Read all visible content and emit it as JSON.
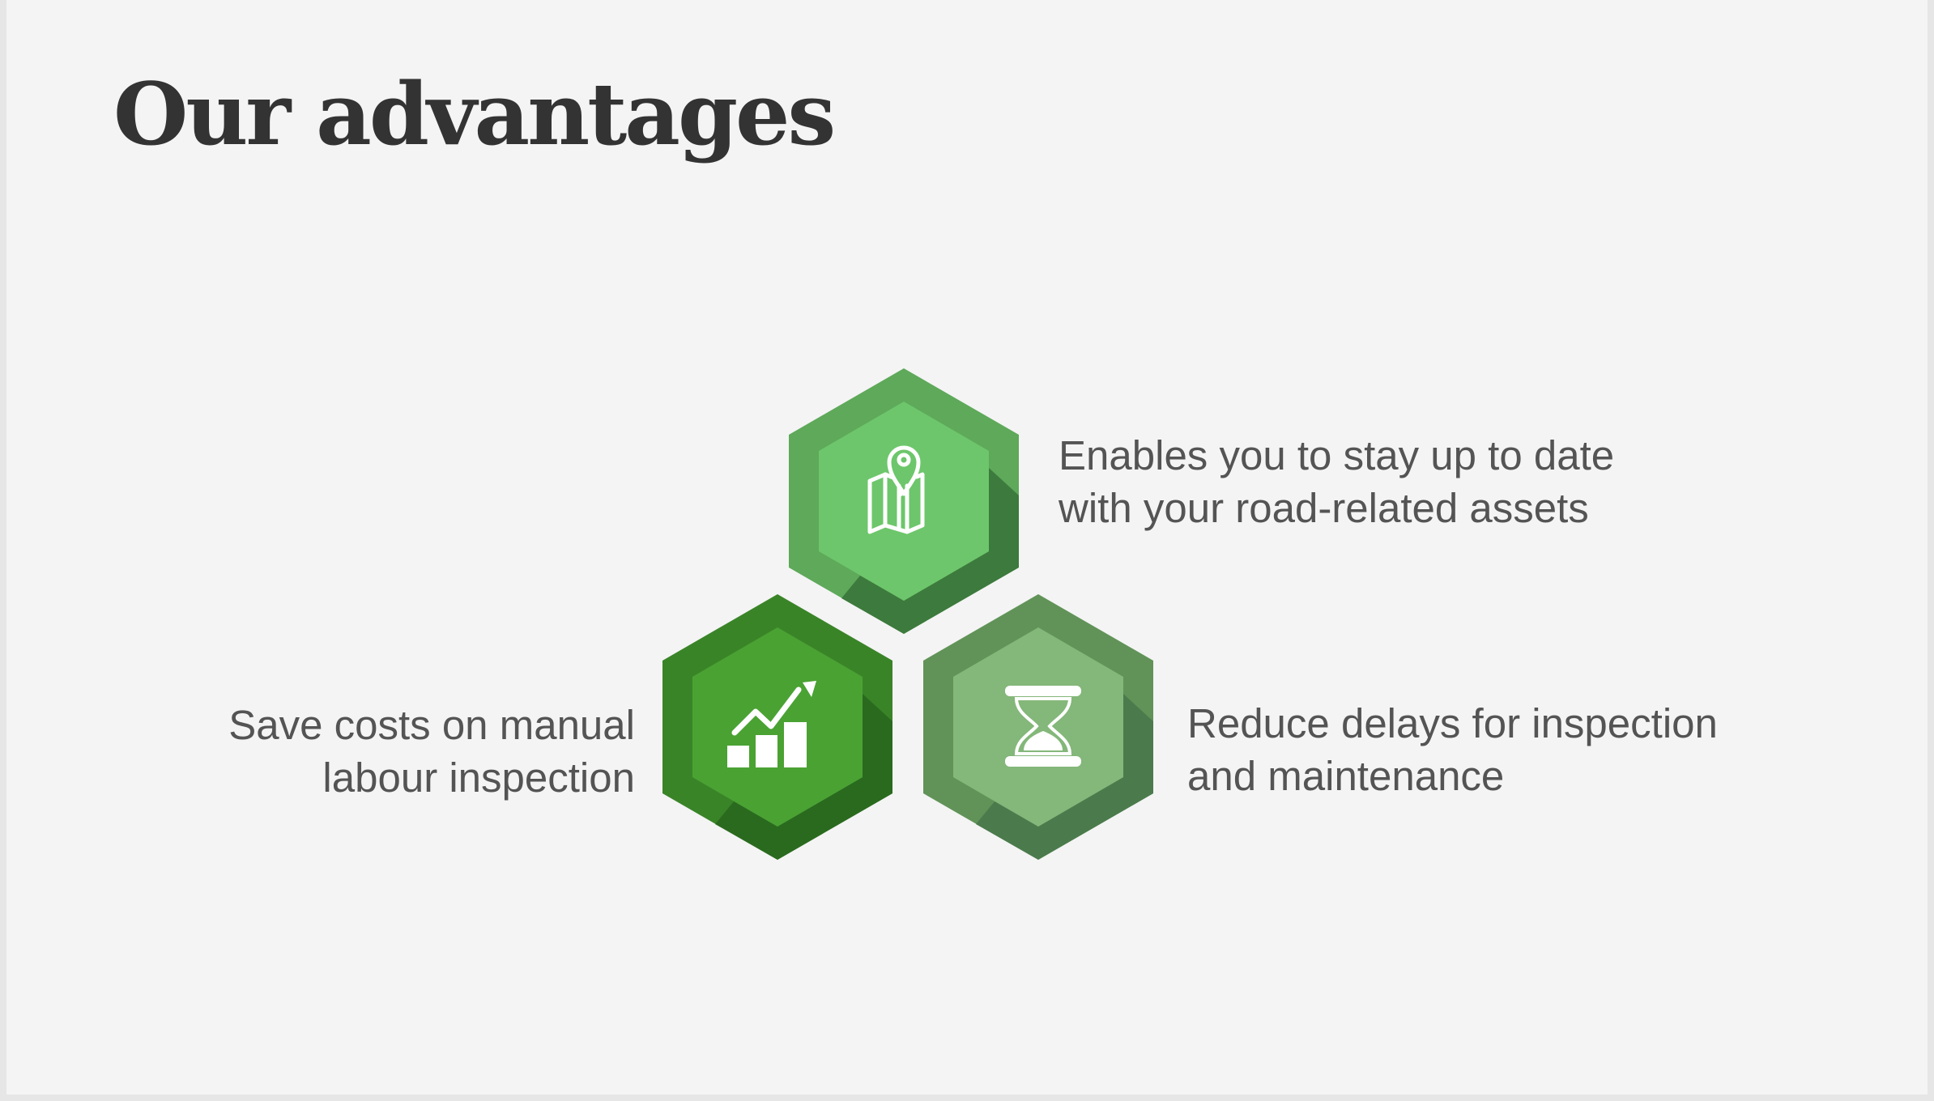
{
  "slide": {
    "title": "Our advantages"
  },
  "advantages": [
    {
      "icon": "map-pin-icon",
      "line1": "Enables you to stay up to date",
      "line2": "with your road-related assets",
      "colors": {
        "outer": "#5ea95a",
        "inner": "#6dc66b",
        "shadow": "#3d7a3d"
      }
    },
    {
      "icon": "growth-chart-icon",
      "line1": "Save costs on manual",
      "line2": "labour inspection",
      "colors": {
        "outer": "#3a8428",
        "inner": "#4aa233",
        "shadow": "#2a6a1f"
      }
    },
    {
      "icon": "hourglass-icon",
      "line1": "Reduce delays for inspection",
      "line2": "and maintenance",
      "colors": {
        "outer": "#619358",
        "inner": "#84b77a",
        "shadow": "#4b7b4c"
      }
    }
  ]
}
